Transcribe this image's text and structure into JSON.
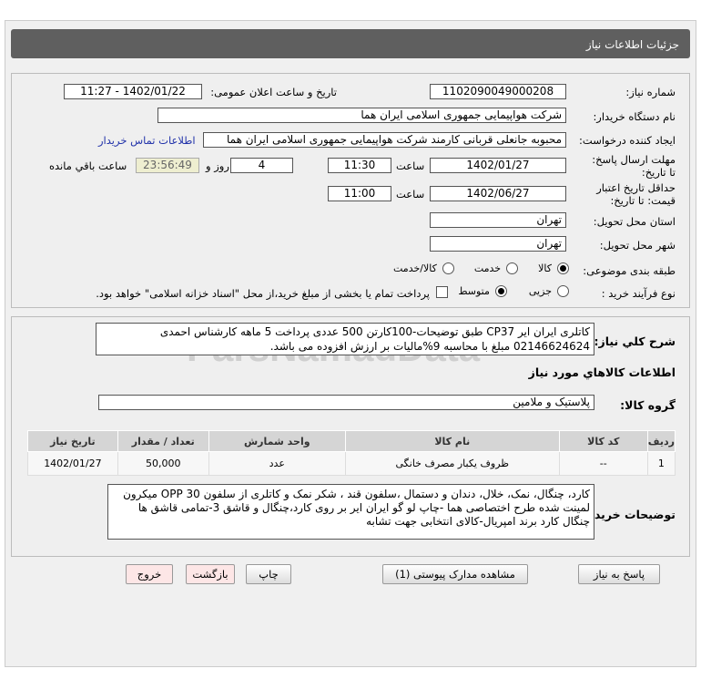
{
  "header": {
    "title": "جزئیات اطلاعات نیاز"
  },
  "form": {
    "need_number_label": "شماره نیاز:",
    "need_number": "1102090049000208",
    "announce_label": "تاریخ و ساعت اعلان عمومی:",
    "announce_value": "1402/01/22 - 11:27",
    "buyer_org_label": "نام دستگاه خریدار:",
    "buyer_org": "شرکت هواپیمایی جمهوری اسلامی ایران هما",
    "creator_label": "ایجاد کننده درخواست:",
    "creator": "محبوبه جانعلی قربانی کارمند شرکت هواپیمایی جمهوری اسلامی ایران هما",
    "contact_link": "اطلاعات تماس خریدار",
    "deadline_label": "مهلت ارسال پاسخ: تا تاریخ:",
    "deadline_date": "1402/01/27",
    "time_label": "ساعت",
    "deadline_time": "11:30",
    "days": "4",
    "days_label": "روز و",
    "remaining": "23:56:49",
    "remaining_label": "ساعت باقي مانده",
    "validity_label": "حداقل تاریخ اعتبار قیمت: تا تاریخ:",
    "validity_date": "1402/06/27",
    "validity_time": "11:00",
    "province_label": "استان محل تحویل:",
    "province": "تهران",
    "city_label": "شهر محل تحویل:",
    "city": "تهران",
    "category_label": "طبقه بندی موضوعی:",
    "category_options": [
      {
        "label": "کالا",
        "selected": true
      },
      {
        "label": "خدمت",
        "selected": false
      },
      {
        "label": "کالا/خدمت",
        "selected": false
      }
    ],
    "process_label": "نوع فرآیند خرید :",
    "process_options": [
      {
        "label": "جزیی",
        "selected": false
      },
      {
        "label": "متوسط",
        "selected": true
      }
    ],
    "treasury_text": "پرداخت تمام یا بخشی از مبلغ خرید،از محل \"اسناد خزانه اسلامی\" خواهد بود."
  },
  "details": {
    "summary_label": "شرح كلي نياز:",
    "summary_line1": "کاتلری ایران ایر CP37  طبق توضیحات-100کارتن 500 عددی پرداخت 5 ماهه کارشناس احمدی",
    "summary_line2": "02146624624 مبلغ با محاسبه 9%مالیات بر ارزش افزوده می باشد.",
    "goods_title": "اطلاعات كالاهاي مورد نياز",
    "group_label": "گروه کالا:",
    "group": "پلاستیک و ملامین",
    "table": {
      "headers": [
        "ردیف",
        "کد کالا",
        "نام کالا",
        "واحد شمارش",
        "تعداد / مقدار",
        "تاریخ نیاز"
      ],
      "rows": [
        [
          "1",
          "--",
          "ظروف یکبار مصرف خانگی",
          "عدد",
          "50,000",
          "1402/01/27"
        ]
      ]
    },
    "buyer_notes_label": "توضیحات خریدار:",
    "buyer_notes": "کارد، چنگال، نمک، خلال، دندان و دستمال ،سلفون قند ، شکر نمک و کاتلری از سلفون OPP 30 میکرون لمینت شده طرح اختصاصی هما -چاپ لو گو ایران ایر بر روی کارد،چنگال و قاشق 3-تمامی قاشق ها چنگال کارد برند امپریال-کالای انتخابی جهت تشابه"
  },
  "buttons": {
    "reply": "پاسخ به نیاز",
    "docs": "مشاهده مدارک پیوستی (1)",
    "print": "چاپ",
    "back": "بازگشت",
    "exit": "خروج"
  },
  "watermark": "ParsNamadData"
}
